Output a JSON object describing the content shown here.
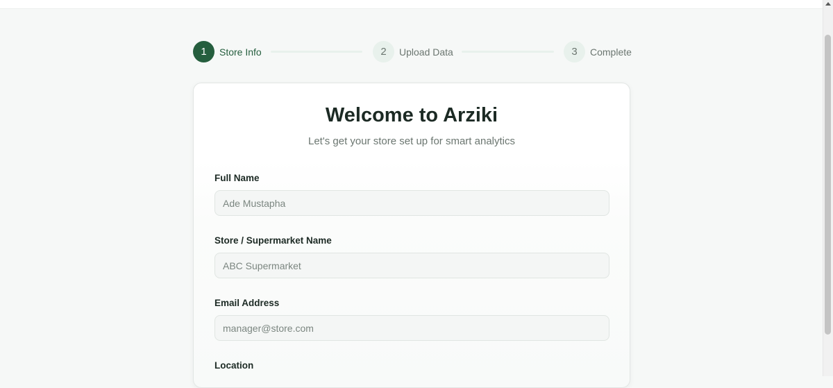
{
  "stepper": {
    "steps": [
      {
        "number": "1",
        "label": "Store Info",
        "state": "active"
      },
      {
        "number": "2",
        "label": "Upload Data",
        "state": "inactive"
      },
      {
        "number": "3",
        "label": "Complete",
        "state": "inactive"
      }
    ]
  },
  "card": {
    "title": "Welcome to Arziki",
    "subtitle": "Let's get your store set up for smart analytics"
  },
  "form": {
    "full_name": {
      "label": "Full Name",
      "value": "",
      "placeholder": "Ade Mustapha"
    },
    "store_name": {
      "label": "Store / Supermarket Name",
      "value": "",
      "placeholder": "ABC Supermarket"
    },
    "email": {
      "label": "Email Address",
      "value": "",
      "placeholder": "manager@store.com"
    },
    "location": {
      "label": "Location"
    }
  },
  "colors": {
    "accent": "#255e3e",
    "step_inactive_bg": "#e8f1ec",
    "page_bg": "#f6f8f7"
  }
}
